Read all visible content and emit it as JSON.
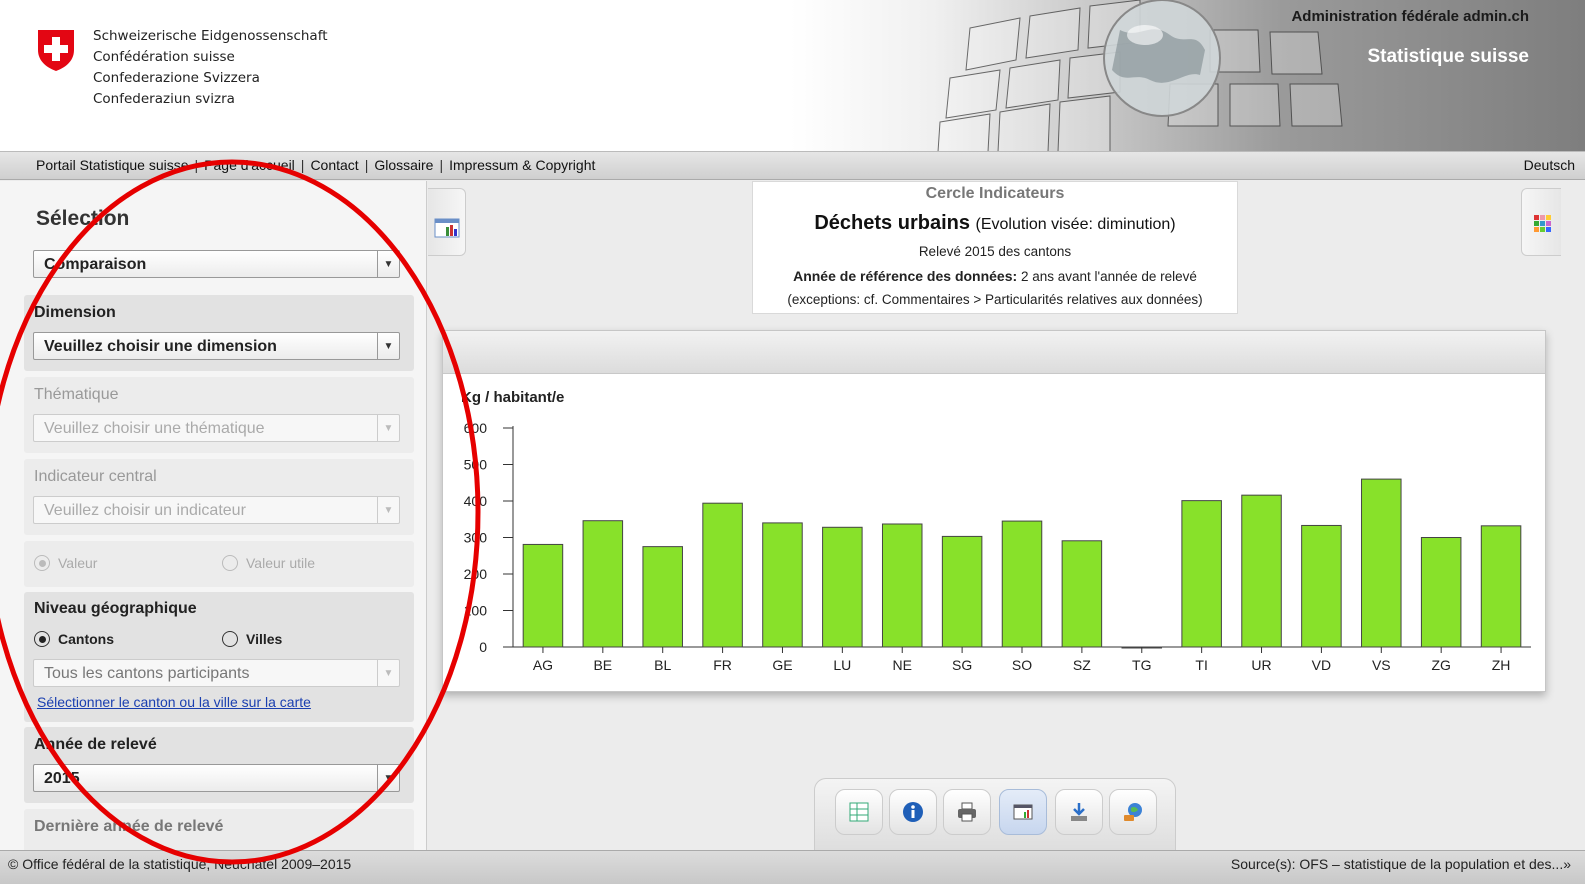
{
  "header": {
    "confederation_names": [
      "Schweizerische Eidgenossenschaft",
      "Confédération suisse",
      "Confederazione Svizzera",
      "Confederaziun svizra"
    ],
    "admin_label": "Administration fédérale admin.ch",
    "site_title": "Statistique suisse"
  },
  "nav": {
    "links": [
      "Portail Statistique suisse",
      "Page d'accueil",
      "Contact",
      "Glossaire",
      "Impressum & Copyright"
    ],
    "language": "Deutsch"
  },
  "sidebar": {
    "title": "Sélection",
    "mode_select": "Comparaison",
    "dimension": {
      "label": "Dimension",
      "value": "Veuillez choisir une dimension"
    },
    "thematique": {
      "label": "Thématique",
      "value": "Veuillez choisir une thématique"
    },
    "indicateur": {
      "label": "Indicateur central",
      "value": "Veuillez choisir un indicateur"
    },
    "value_radios": {
      "option1": "Valeur",
      "option2": "Valeur utile"
    },
    "geo": {
      "label": "Niveau géographique",
      "option1": "Cantons",
      "option2": "Villes",
      "select_value": "Tous les cantons participants",
      "map_link": "Sélectionner le canton ou la ville sur la carte"
    },
    "annee": {
      "label": "Année de relevé",
      "value": "2015"
    },
    "derniere": {
      "label": "Dernière année de relevé"
    }
  },
  "info": {
    "subtitle": "Cercle Indicateurs",
    "title": "Déchets urbains",
    "title_note": "(Evolution visée: diminution)",
    "line3": "Relevé 2015 des cantons",
    "line4_bold": "Année de référence des données:",
    "line4_rest": "2 ans avant l'année de relevé",
    "line5": "(exceptions: cf. Commentaires > Particularités relatives aux données)"
  },
  "chart_data": {
    "type": "bar",
    "ylabel": "Kg / habitant/e",
    "ylim": [
      0,
      600
    ],
    "yticks": [
      0,
      100,
      200,
      300,
      400,
      500,
      600
    ],
    "categories": [
      "AG",
      "BE",
      "BL",
      "FR",
      "GE",
      "LU",
      "NE",
      "SG",
      "SO",
      "SZ",
      "TG",
      "TI",
      "UR",
      "VD",
      "VS",
      "ZG",
      "ZH"
    ],
    "values": [
      281,
      346,
      275,
      394,
      340,
      328,
      337,
      303,
      345,
      291,
      0,
      401,
      416,
      333,
      460,
      300,
      332
    ],
    "bar_color": "#88e12a",
    "grid": false
  },
  "toolbar": {
    "icons": [
      "table-icon",
      "info-icon",
      "print-icon",
      "chart-icon",
      "download-icon",
      "share-icon"
    ]
  },
  "footer": {
    "left": "© Office fédéral de la statistique, Neuchâtel 2009–2015",
    "right": "Source(s): OFS – statistique de la population et des...»"
  }
}
